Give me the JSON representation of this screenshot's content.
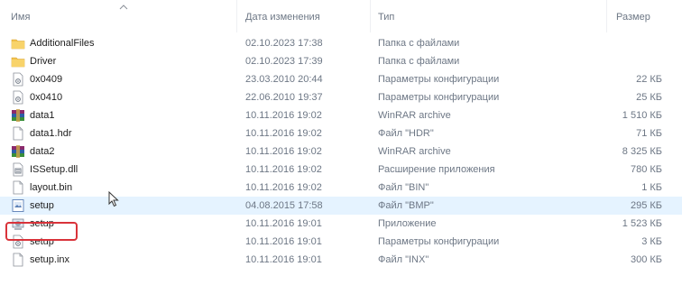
{
  "columns": {
    "name": "Имя",
    "date": "Дата изменения",
    "type": "Тип",
    "size": "Размер"
  },
  "files": [
    {
      "name": "AdditionalFiles",
      "date": "02.10.2023 17:38",
      "type": "Папка с файлами",
      "size": "",
      "icon": "folder-icon"
    },
    {
      "name": "Driver",
      "date": "02.10.2023 17:39",
      "type": "Папка с файлами",
      "size": "",
      "icon": "folder-icon"
    },
    {
      "name": "0x0409",
      "date": "23.03.2010 20:44",
      "type": "Параметры конфигурации",
      "size": "22 КБ",
      "icon": "config-file-icon"
    },
    {
      "name": "0x0410",
      "date": "22.06.2010 19:37",
      "type": "Параметры конфигурации",
      "size": "25 КБ",
      "icon": "config-file-icon"
    },
    {
      "name": "data1",
      "date": "10.11.2016 19:02",
      "type": "WinRAR archive",
      "size": "1 510 КБ",
      "icon": "winrar-archive-icon"
    },
    {
      "name": "data1.hdr",
      "date": "10.11.2016 19:02",
      "type": "Файл \"HDR\"",
      "size": "71 КБ",
      "icon": "file-icon"
    },
    {
      "name": "data2",
      "date": "10.11.2016 19:02",
      "type": "WinRAR archive",
      "size": "8 325 КБ",
      "icon": "winrar-archive-icon"
    },
    {
      "name": "ISSetup.dll",
      "date": "10.11.2016 19:02",
      "type": "Расширение приложения",
      "size": "780 КБ",
      "icon": "dll-file-icon"
    },
    {
      "name": "layout.bin",
      "date": "10.11.2016 19:02",
      "type": "Файл \"BIN\"",
      "size": "1 КБ",
      "icon": "file-icon"
    },
    {
      "name": "setup",
      "date": "04.08.2015 17:58",
      "type": "Файл \"BMP\"",
      "size": "295 КБ",
      "icon": "bitmap-file-icon"
    },
    {
      "name": "setup",
      "date": "10.11.2016 19:01",
      "type": "Приложение",
      "size": "1 523 КБ",
      "icon": "setup-application-icon"
    },
    {
      "name": "setup",
      "date": "10.11.2016 19:01",
      "type": "Параметры конфигурации",
      "size": "3 КБ",
      "icon": "config-file-icon"
    },
    {
      "name": "setup.inx",
      "date": "10.11.2016 19:01",
      "type": "Файл \"INX\"",
      "size": "300 КБ",
      "icon": "file-icon"
    }
  ],
  "hovered_row": 9,
  "highlighted_row": 11,
  "colors": {
    "folder": "#f2c14e",
    "hover": "#e5f3ff",
    "highlight": "#d9333a",
    "header_text": "#6d7785"
  }
}
